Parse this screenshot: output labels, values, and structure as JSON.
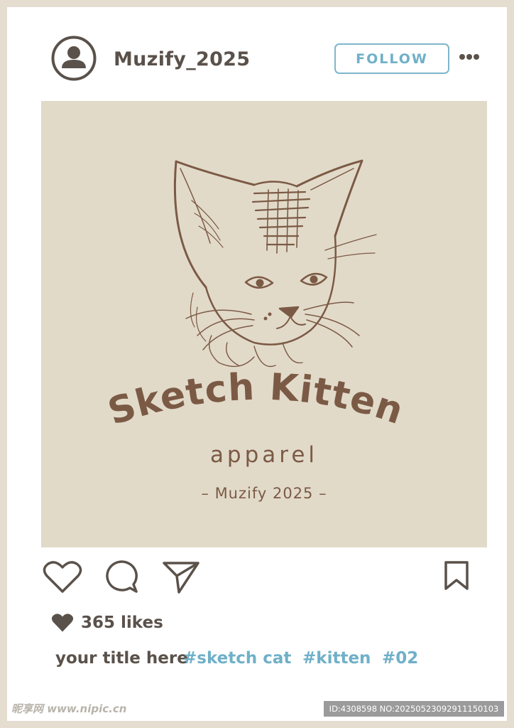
{
  "header": {
    "username": "Muzify_2025",
    "follow_label": "FOLLOW",
    "avatar_icon": "user-icon",
    "more_icon": "more-dots-icon"
  },
  "post": {
    "brand_title": "Sketch Kitten",
    "brand_subtitle": "apparel",
    "signature": "– Muzify 2025 –",
    "background_color": "#e2dac9",
    "ink_color": "#7b5a45"
  },
  "actions": {
    "like_icon": "heart-icon",
    "comment_icon": "comment-icon",
    "share_icon": "send-icon",
    "save_icon": "bookmark-icon"
  },
  "stats": {
    "likes_text": "365 likes"
  },
  "caption": {
    "title": "your title here",
    "tags": [
      "#sketch cat",
      "#kitten",
      "#02"
    ]
  },
  "footer": {
    "watermark": "昵享网 www.nipic.cn",
    "id_text": "ID:4308598 NO:20250523092911150103"
  },
  "colors": {
    "frame": "#e4ddd0",
    "text_dark": "#5a514a",
    "accent_blue": "#6fb0c8"
  }
}
